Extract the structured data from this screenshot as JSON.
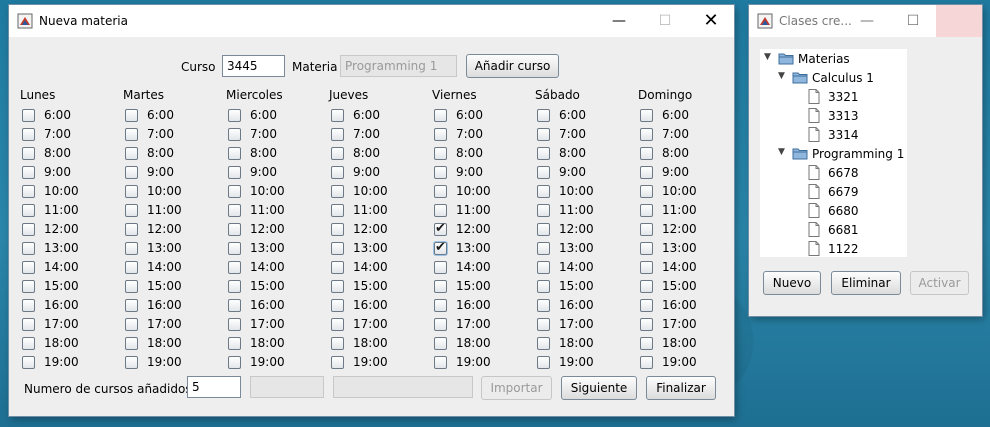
{
  "main_window": {
    "title": "Nueva materia",
    "curso_label": "Curso",
    "curso_value": "3445",
    "materia_label": "Materia",
    "materia_value": "Programming 1",
    "add_course_button": "Añadir curso",
    "days": [
      "Lunes",
      "Martes",
      "Miercoles",
      "Jueves",
      "Viernes",
      "Sábado",
      "Domingo"
    ],
    "hours": [
      "6:00",
      "7:00",
      "8:00",
      "9:00",
      "10:00",
      "11:00",
      "12:00",
      "13:00",
      "14:00",
      "15:00",
      "16:00",
      "17:00",
      "18:00",
      "19:00"
    ],
    "checked": [
      {
        "day": "Viernes",
        "hour": "12:00"
      },
      {
        "day": "Viernes",
        "hour": "13:00"
      }
    ],
    "count_label": "Numero de cursos añadidos",
    "count_value": "5",
    "import_button": "Importar",
    "next_button": "Siguiente",
    "finish_button": "Finalizar"
  },
  "side_window": {
    "title": "Clases cre...",
    "tree": {
      "root": "Materias",
      "subjects": [
        {
          "name": "Calculus 1",
          "courses": [
            "3321",
            "3313",
            "3314"
          ]
        },
        {
          "name": "Programming 1",
          "courses": [
            "6678",
            "6679",
            "6680",
            "6681",
            "1122"
          ]
        }
      ]
    },
    "new_button": "Nuevo",
    "delete_button": "Eliminar",
    "activate_button": "Activar"
  },
  "icons": {
    "minimize": "minimize-icon",
    "maximize": "maximize-icon",
    "close": "close-icon"
  }
}
